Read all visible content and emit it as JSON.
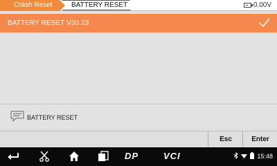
{
  "breadcrumb": {
    "items": [
      "Crash Reset",
      "BATTERY RESET"
    ]
  },
  "battery": {
    "voltage": "0.00V"
  },
  "menu": {
    "items": [
      {
        "label": "BATTERY RESET  V30.23",
        "selected": true
      }
    ]
  },
  "message": {
    "text": "BATTERY RESET"
  },
  "actions": {
    "esc": "Esc",
    "enter": "Enter"
  },
  "navbar": {
    "dp": "DP",
    "vci": "VCI",
    "time": "15:48"
  },
  "colors": {
    "accent": "#f5894d",
    "crumb": "#f08a3c",
    "navbar": "#0a0a0a"
  }
}
